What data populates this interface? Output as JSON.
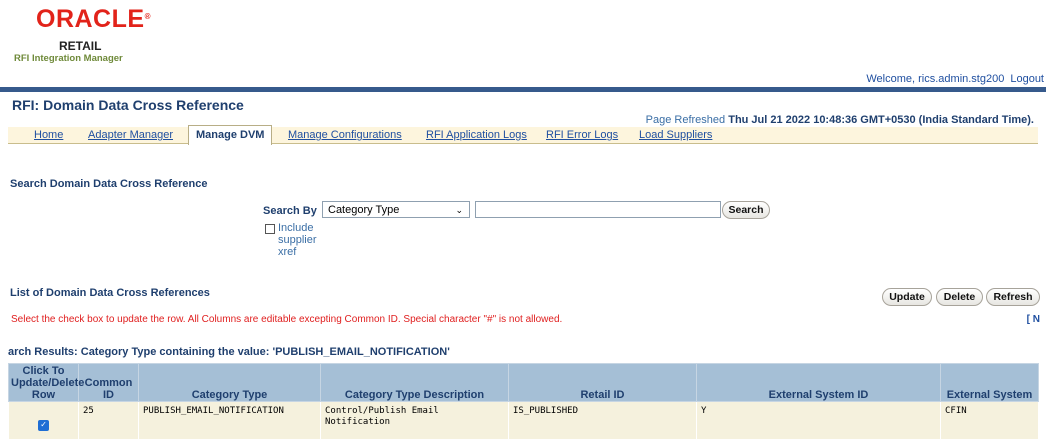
{
  "brand": {
    "oracle": "ORACLE",
    "retail": "RETAIL",
    "product": "RFI Integration Manager"
  },
  "header": {
    "welcome": "Welcome, rics.admin.stg200",
    "logout": "Logout"
  },
  "page": {
    "title": "RFI: Domain Data Cross Reference",
    "refreshed_label": "Page Refreshed",
    "refreshed_value": "Thu Jul 21 2022 10:48:36 GMT+0530 (India Standard Time)."
  },
  "tabs": [
    "Home",
    "Adapter Manager",
    "Manage DVM",
    "Manage Configurations",
    "RFI Application Logs",
    "RFI Error Logs",
    "Load Suppliers"
  ],
  "active_tab": "Manage DVM",
  "search": {
    "heading": "Search Domain Data Cross Reference",
    "label": "Search By",
    "selected": "Category Type",
    "value": "",
    "button": "Search",
    "include_label": "Include supplier xref"
  },
  "list": {
    "heading": "List of Domain Data Cross References",
    "buttons": {
      "update": "Update",
      "delete": "Delete",
      "refresh": "Refresh"
    },
    "note": "Select the check box to update the row. All Columns are editable excepting Common ID. Special character \"#\" is not allowed.",
    "link": "[ N"
  },
  "results": {
    "heading": "arch Results: Category Type containing the value: 'PUBLISH_EMAIL_NOTIFICATION'",
    "columns": [
      "Click To Update/Delete Row",
      "Common ID",
      "Category Type",
      "Category Type Description",
      "Retail ID",
      "External System ID",
      "External System"
    ],
    "rows": [
      {
        "checked": true,
        "common_id": "25",
        "category_type": "PUBLISH_EMAIL_NOTIFICATION",
        "description": "Control/Publish Email Notification",
        "retail_id": "IS_PUBLISHED",
        "external_system_id": "Y",
        "external_system": "CFIN"
      }
    ]
  },
  "colors": {
    "accent": "#365a8c",
    "brand_red": "#e2231a",
    "header_bg": "#a5bfd6",
    "tab_bg": "#fdf5dd",
    "note": "#e02020"
  }
}
